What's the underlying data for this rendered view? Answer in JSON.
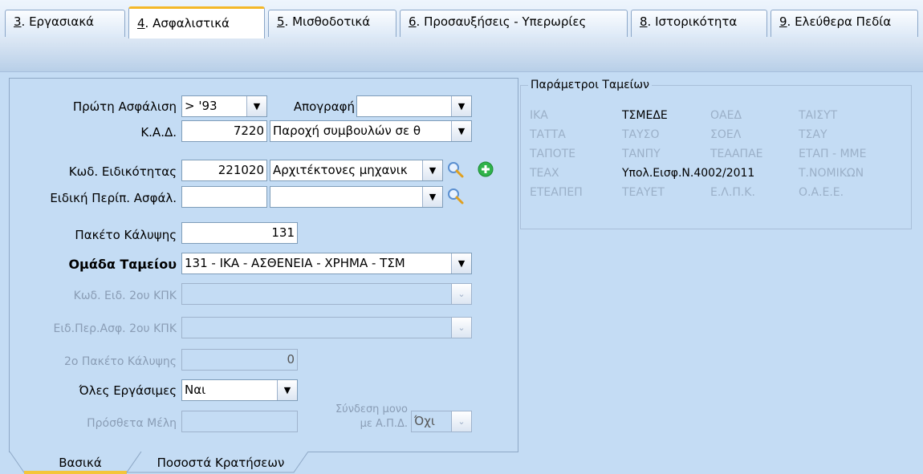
{
  "tabs": [
    {
      "mnemonic": "3",
      "label": ". Εργασιακά",
      "active": false
    },
    {
      "mnemonic": "4",
      "label": ". Ασφαλιστικά",
      "active": true
    },
    {
      "mnemonic": "5",
      "label": ". Μισθοδοτικά",
      "active": false
    },
    {
      "mnemonic": "6",
      "label": ". Προσαυξήσεις - Υπερωρίες",
      "active": false
    },
    {
      "mnemonic": "8",
      "label": ". Ιστορικότητα",
      "active": false
    },
    {
      "mnemonic": "9",
      "label": ". Ελεύθερα Πεδία",
      "active": false
    }
  ],
  "form": {
    "first_insurance": {
      "label": "Πρώτη Ασφάλιση",
      "value": "> '93"
    },
    "inventory": {
      "label": "Απογραφή",
      "value": ""
    },
    "kad": {
      "label": "Κ.Α.Δ.",
      "code": "7220",
      "desc": "Παροχή συμβουλών σε θ"
    },
    "specialty": {
      "label": "Κωδ. Ειδικότητας",
      "code": "221020",
      "desc": "Αρχιτέκτονες μηχανικ"
    },
    "special_case": {
      "label": "Ειδική Περίπ. Ασφάλ.",
      "code": "",
      "desc": ""
    },
    "coverage_package": {
      "label": "Πακέτο Κάλυψης",
      "value": "131"
    },
    "fund_group": {
      "label": "Ομάδα Ταμείου",
      "value": "131 - ΙΚΑ - ΑΣΘΕΝΕΙΑ - ΧΡΗΜΑ - ΤΣΜ"
    },
    "specialty2": {
      "label": "Κωδ. Ειδ. 2ου ΚΠΚ",
      "value": ""
    },
    "special_case2": {
      "label": "Ειδ.Περ.Ασφ. 2ου ΚΠΚ",
      "value": ""
    },
    "coverage_package2": {
      "label": "2ο Πακέτο Κάλυψης",
      "value": "0"
    },
    "all_workdays": {
      "label": "Όλες Εργάσιμες",
      "value": "Ναι"
    },
    "extra_members": {
      "label": "Πρόσθετα Μέλη",
      "value": ""
    },
    "link_apd": {
      "label_line1": "Σύνδεση μονο",
      "label_line2": "με Α.Π.Δ.",
      "value": "Όχι"
    }
  },
  "bottom_tabs": [
    {
      "label": "Βασικά",
      "active": true
    },
    {
      "label": "Ποσοστά Κρατήσεων",
      "active": false
    }
  ],
  "params": {
    "title": "Παράμετροι Ταμείων",
    "rows": [
      [
        {
          "t": "ΙΚΑ",
          "on": false
        },
        {
          "t": "ΤΣΜΕΔΕ",
          "on": true
        },
        {
          "t": "ΟΑΕΔ",
          "on": false
        },
        {
          "t": "ΤΑΙΣΥΤ",
          "on": false
        }
      ],
      [
        {
          "t": "ΤΑΤΤΑ",
          "on": false
        },
        {
          "t": "ΤΑΥΣΟ",
          "on": false
        },
        {
          "t": "ΣΟΕΛ",
          "on": false
        },
        {
          "t": "ΤΣΑΥ",
          "on": false
        }
      ],
      [
        {
          "t": "ΤΑΠΟΤΕ",
          "on": false
        },
        {
          "t": "ΤΑΝΠΥ",
          "on": false
        },
        {
          "t": "ΤΕΑΑΠΑΕ",
          "on": false
        },
        {
          "t": "ΕΤΑΠ - ΜΜΕ",
          "on": false
        }
      ],
      [
        {
          "t": "ΤΕΑΧ",
          "on": false
        },
        {
          "t": "Υπολ.Εισφ.Ν.4002/2011",
          "on": true
        },
        {
          "t": "",
          "on": false
        },
        {
          "t": "Τ.ΝΟΜΙΚΩΝ",
          "on": false
        }
      ],
      [
        {
          "t": "ΕΤΕΑΠΕΠ",
          "on": false
        },
        {
          "t": "ΤΕΑΥΕΤ",
          "on": false
        },
        {
          "t": "Ε.Λ.Π.Κ.",
          "on": false
        },
        {
          "t": "Ο.Α.Ε.Ε.",
          "on": false
        }
      ]
    ]
  },
  "colors": {
    "background": "#c4dcf4",
    "active_tab_accent": "#f4b829",
    "disabled_text": "#8a9db5",
    "add_icon": "#2fb34a"
  }
}
